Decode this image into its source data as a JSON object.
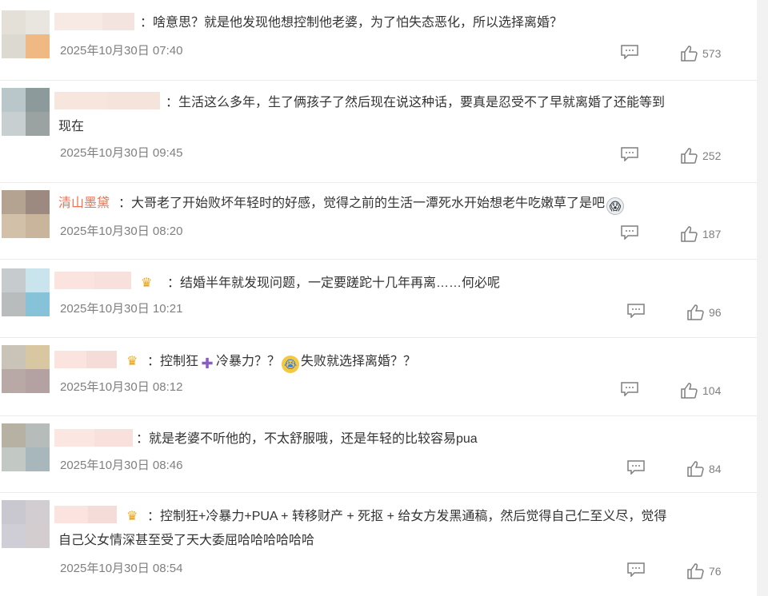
{
  "comments": [
    {
      "username_visible": "",
      "text": "：啥意思？就是他发现他想控制他老婆，为了怕失态恶化，所以选择离婚？",
      "time": "2025年10月30日 07:40",
      "likes": "573"
    },
    {
      "username_visible": "",
      "text_line1": "：生活这么多年，生了俩孩子了然后现在说这种话，要真是忍受不了早就离婚了还能等到",
      "text_line2": "现在",
      "time": "2025年10月30日 09:45",
      "likes": "252"
    },
    {
      "username_visible": "清山墨黛",
      "text": "：大哥老了开始败坏年轻时的好感，觉得之前的生活一潭死水开始想老牛吃嫩草了是吧",
      "time": "2025年10月30日 08:20",
      "likes": "187"
    },
    {
      "username_visible": "",
      "text": "：结婚半年就发现问题，一定要蹉跎十几年再离……何必呢",
      "time": "2025年10月30日 10:21",
      "likes": "96"
    },
    {
      "username_visible": "",
      "text_a": "：控制狂",
      "text_b": "冷暴力？？",
      "text_c": "失败就选择离婚？？",
      "time": "2025年10月30日 08:12",
      "likes": "104"
    },
    {
      "username_visible": "",
      "text": "：就是老婆不听他的，不太舒服哦，还是年轻的比较容易pua",
      "time": "2025年10月30日 08:46",
      "likes": "84"
    },
    {
      "username_visible": "",
      "text_line1": "：控制狂+冷暴力+PUA + 转移财产 + 死抠 + 给女方发黑通稿，然后觉得自己仁至义尽，觉得",
      "text_line2": "自己父女情深甚至受了天大委屈哈哈哈哈哈哈",
      "time": "2025年10月30日 08:54",
      "likes": "76"
    }
  ],
  "icons": {
    "reply": "comment-icon",
    "like": "thumbs-up-icon",
    "crown": "crown-icon"
  },
  "colors": {
    "username": "#eb7350",
    "meta": "#7f7f7f",
    "text": "#333333"
  }
}
